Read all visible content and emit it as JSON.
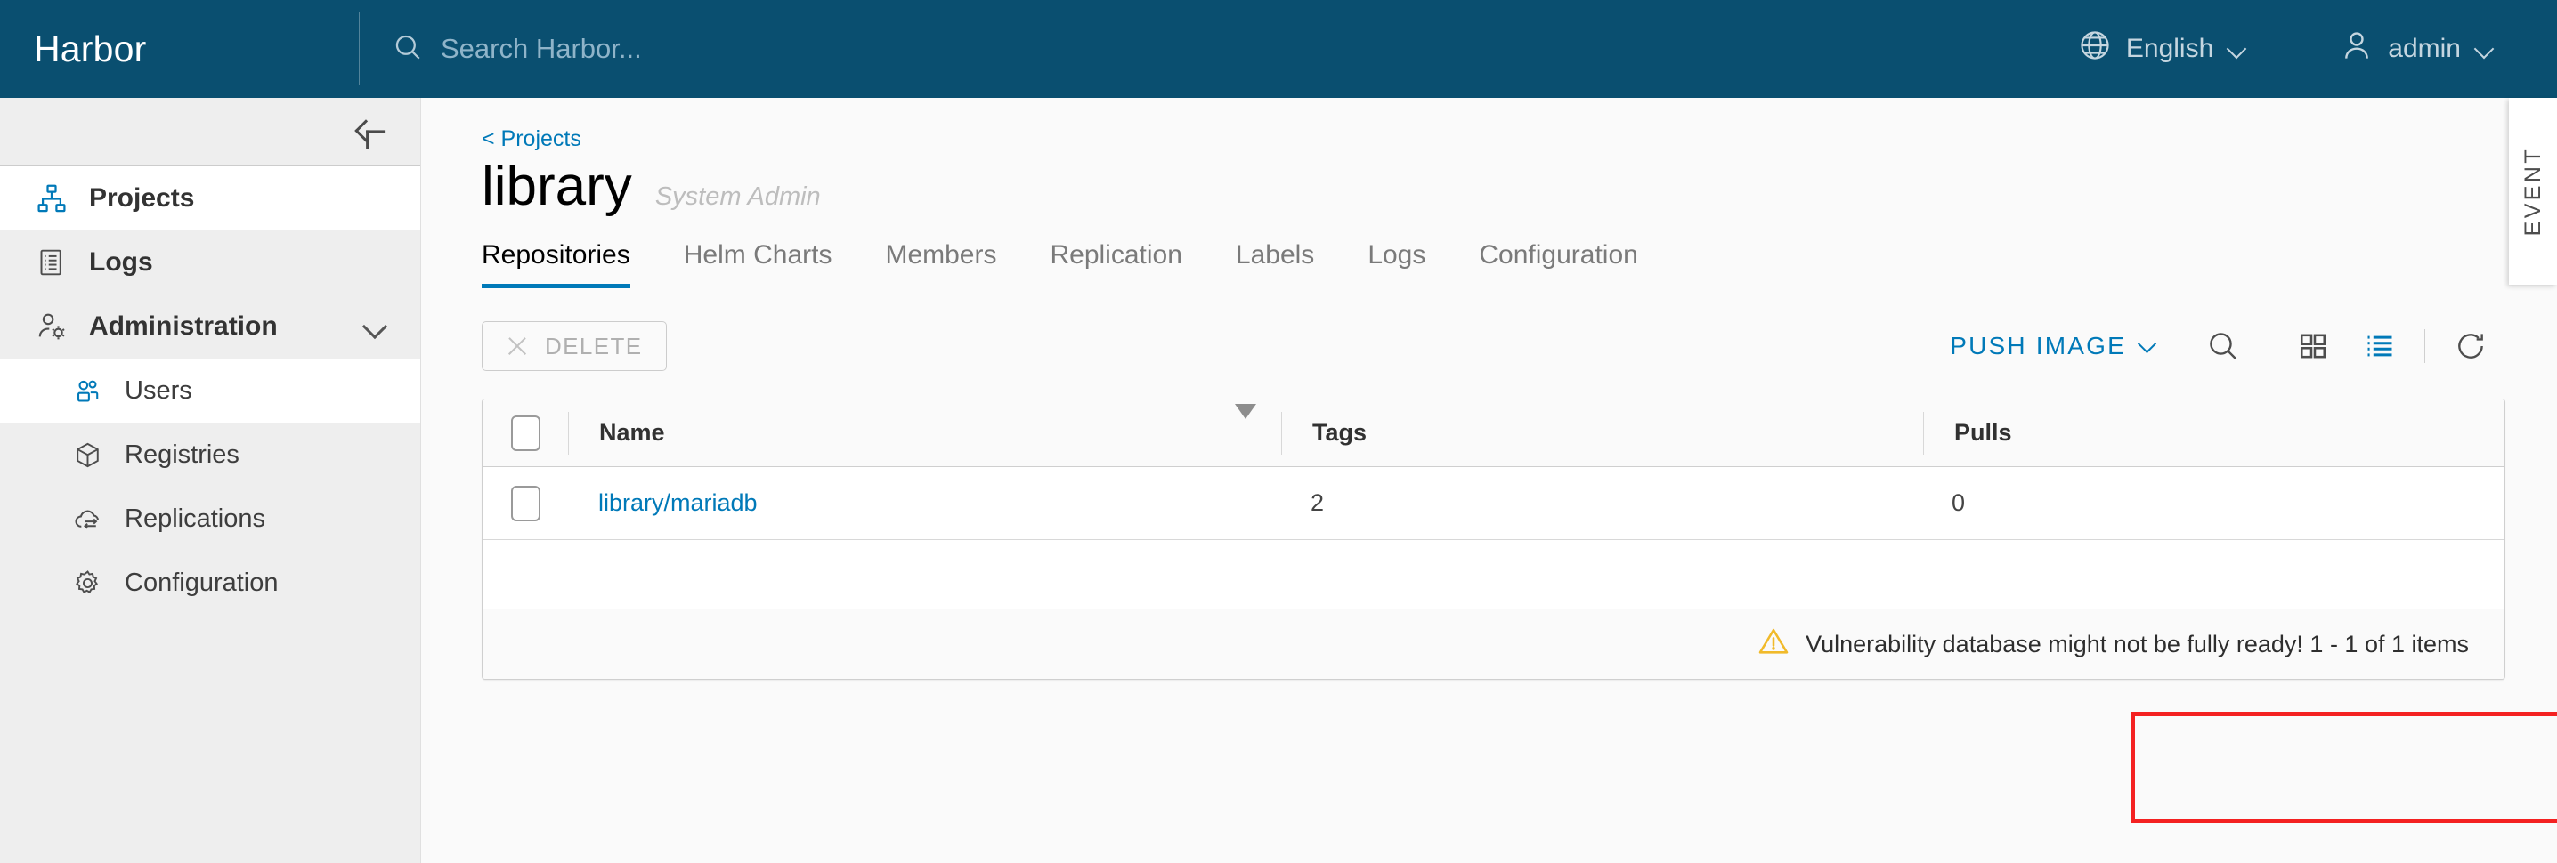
{
  "header": {
    "brand": "Harbor",
    "search_placeholder": "Search Harbor...",
    "language": "English",
    "user": "admin"
  },
  "sidebar": {
    "items": [
      {
        "label": "Projects",
        "icon": "projects-icon",
        "active": true
      },
      {
        "label": "Logs",
        "icon": "logs-icon",
        "active": false
      },
      {
        "label": "Administration",
        "icon": "administration-icon",
        "active": false,
        "expanded": true
      }
    ],
    "sub_items": [
      {
        "label": "Users",
        "icon": "users-icon",
        "active": true
      },
      {
        "label": "Registries",
        "icon": "registries-icon",
        "active": false
      },
      {
        "label": "Replications",
        "icon": "replications-icon",
        "active": false
      },
      {
        "label": "Configuration",
        "icon": "configuration-icon",
        "active": false
      }
    ]
  },
  "main": {
    "breadcrumb": "< Projects",
    "project_name": "library",
    "project_role": "System Admin",
    "tabs": [
      {
        "label": "Repositories",
        "active": true
      },
      {
        "label": "Helm Charts",
        "active": false
      },
      {
        "label": "Members",
        "active": false
      },
      {
        "label": "Replication",
        "active": false
      },
      {
        "label": "Labels",
        "active": false
      },
      {
        "label": "Logs",
        "active": false
      },
      {
        "label": "Configuration",
        "active": false
      }
    ],
    "toolbar": {
      "delete_label": "DELETE",
      "push_image_label": "PUSH IMAGE"
    },
    "table": {
      "columns": [
        "Name",
        "Tags",
        "Pulls"
      ],
      "rows": [
        {
          "name": "library/mariadb",
          "tags": "2",
          "pulls": "0"
        }
      ],
      "footer_message": "Vulnerability database might not be fully ready! 1 - 1 of 1 items"
    }
  },
  "event_tab": {
    "label": "EVENT"
  },
  "colors": {
    "header_blue": "#0a4f70",
    "accent_blue": "#0079b8",
    "sidebar_bg": "#eeeeee",
    "annotation_red": "#f42121",
    "warning_yellow": "#f1ba2a"
  }
}
